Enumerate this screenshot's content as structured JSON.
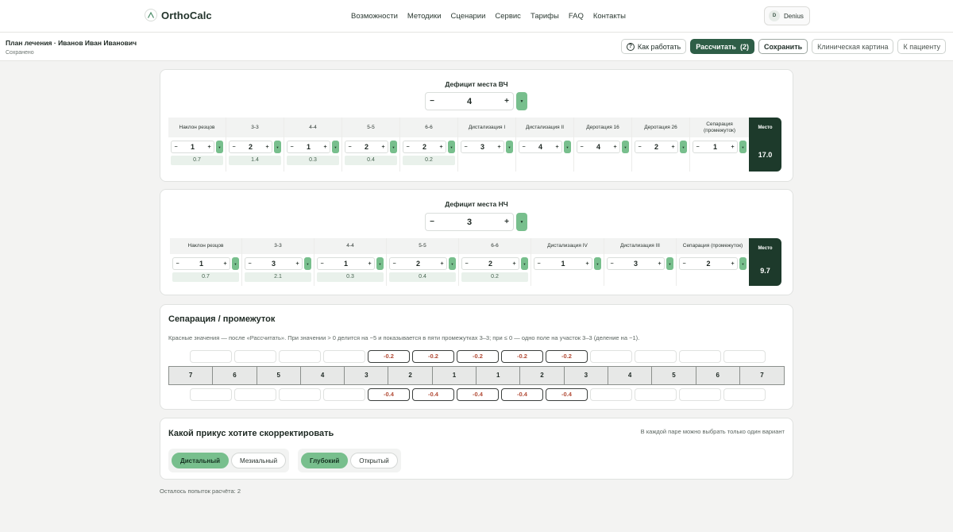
{
  "nav": {
    "brand": "OrthoCalc",
    "menu": [
      "Возможности",
      "Методики",
      "Сценарии",
      "Сервис",
      "Тарифы",
      "FAQ",
      "Контакты"
    ],
    "user_initial": "D",
    "user_name": "Denius"
  },
  "plan": {
    "title": "План лечения · Иванов Иван Иванович",
    "status": "Сохранено",
    "actions": {
      "how": "Как работать",
      "calc": "Рассчитать  (2)",
      "save": "Сохранить",
      "clinical": "Клиническая картина",
      "patient": "К пациенту"
    }
  },
  "upper": {
    "title": "Дефицит места ВЧ",
    "deficit": "4",
    "columns": [
      {
        "label": "Наклон резцов",
        "value": "1",
        "result": "0.7"
      },
      {
        "label": "3-3",
        "value": "2",
        "result": "1.4"
      },
      {
        "label": "4-4",
        "value": "1",
        "result": "0.3"
      },
      {
        "label": "5-5",
        "value": "2",
        "result": "0.4"
      },
      {
        "label": "6-6",
        "value": "2",
        "result": "0.2"
      },
      {
        "label": "Дистализация I",
        "value": "3",
        "result": ""
      },
      {
        "label": "Дистализация II",
        "value": "4",
        "result": ""
      },
      {
        "label": "Деротация 16",
        "value": "4",
        "result": ""
      },
      {
        "label": "Деротация 26",
        "value": "2",
        "result": ""
      },
      {
        "label": "Сепарация (промежуток)",
        "value": "1",
        "result": ""
      }
    ],
    "space_label": "Место",
    "space_value": "17.0"
  },
  "lower": {
    "title": "Дефицит места НЧ",
    "deficit": "3",
    "columns": [
      {
        "label": "Наклон резцов",
        "value": "1",
        "result": "0.7"
      },
      {
        "label": "3-3",
        "value": "3",
        "result": "2.1"
      },
      {
        "label": "4-4",
        "value": "1",
        "result": "0.3"
      },
      {
        "label": "5-5",
        "value": "2",
        "result": "0.4"
      },
      {
        "label": "6-6",
        "value": "2",
        "result": "0.2"
      },
      {
        "label": "Дистализация IV",
        "value": "1",
        "result": ""
      },
      {
        "label": "Дистализация III",
        "value": "3",
        "result": ""
      },
      {
        "label": "Сепарация (промежуток)",
        "value": "2",
        "result": ""
      }
    ],
    "space_label": "Место",
    "space_value": "9.7"
  },
  "separation": {
    "title": "Сепарация / промежуток",
    "description": "Красные значения — после «Рассчитать». При значении > 0 делится на −5 и показывается в пяти промежутках 3–3; при ≤ 0 — одно поле на участок 3–3 (деление на −1).",
    "upper_cells": [
      "",
      "",
      "",
      "",
      "-0.2",
      "-0.2",
      "-0.2",
      "-0.2",
      "-0.2",
      "",
      "",
      "",
      ""
    ],
    "teeth": [
      "7",
      "6",
      "5",
      "4",
      "3",
      "2",
      "1",
      "1",
      "2",
      "3",
      "4",
      "5",
      "6",
      "7"
    ],
    "lower_cells": [
      "",
      "",
      "",
      "",
      "-0.4",
      "-0.4",
      "-0.4",
      "-0.4",
      "-0.4",
      "",
      "",
      "",
      ""
    ]
  },
  "bite": {
    "title": "Какой прикус хотите скорректировать",
    "hint": "В каждой паре можно выбрать только один вариант",
    "group1": [
      "Дистальный",
      "Мезиальный"
    ],
    "group2": [
      "Глубокий",
      "Открытый"
    ]
  },
  "footer": {
    "attempts": "Осталось попыток расчёта: 2"
  },
  "colors": {
    "brand_dark": "#2e5e47",
    "accent_green": "#78bf8d",
    "space_box": "#1d3a2b",
    "negative_red": "#b24b36"
  }
}
